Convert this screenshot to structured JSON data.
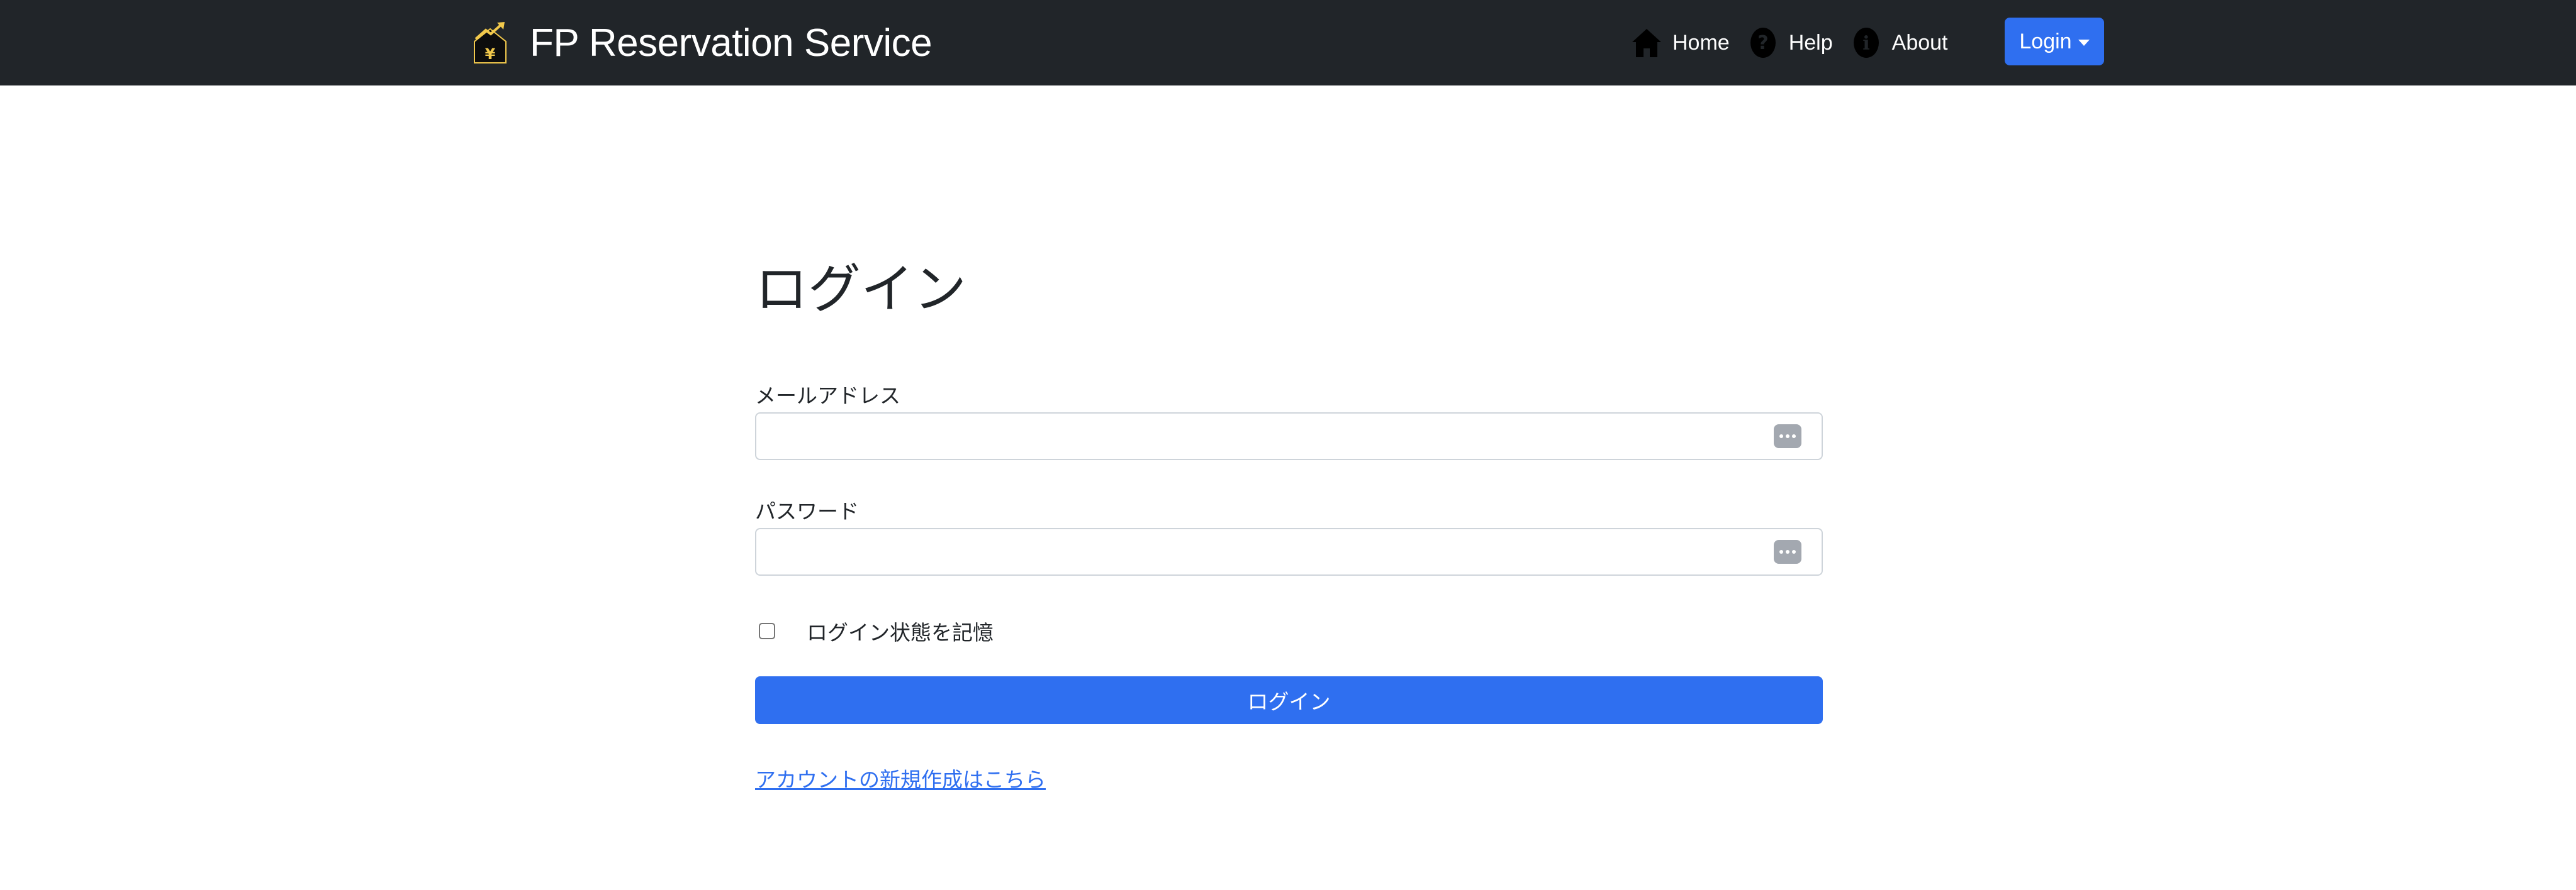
{
  "header": {
    "brand_title": "FP Reservation Service",
    "brand_logo": "house-yen-chart-icon",
    "nav": [
      {
        "label": "Home",
        "icon": "home-icon"
      },
      {
        "label": "Help",
        "icon": "help-icon"
      },
      {
        "label": "About",
        "icon": "info-icon"
      }
    ],
    "login_label": "Login"
  },
  "main": {
    "title": "ログイン",
    "email_label": "メールアドレス",
    "email_value": "",
    "password_label": "パスワード",
    "password_value": "",
    "remember_label": "ログイン状態を記憶",
    "remember_checked": false,
    "submit_label": "ログイン",
    "signup_link": "アカウントの新規作成はこちら"
  },
  "colors": {
    "navbar_bg": "#212529",
    "primary": "#2f6ff0",
    "logo_accent": "#f2c94c"
  }
}
